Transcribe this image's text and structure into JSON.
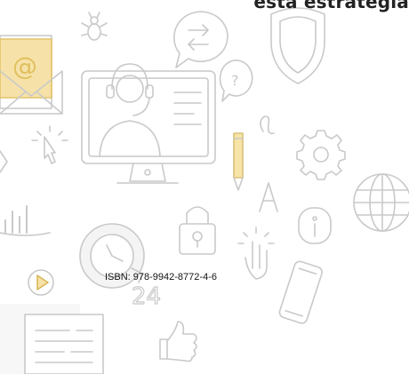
{
  "header": {
    "title": "esta estrategia"
  },
  "footer": {
    "isbn": "ISBN: 978-9942-8772-4-6"
  },
  "colors": {
    "stroke": "#c9c9c9",
    "envelope_accent": "#f6e2a8",
    "pencil_accent": "#f7e4a6",
    "chart_accent": "#f2ecd8",
    "text": "#111111"
  },
  "icons": [
    "envelope-icon",
    "bug-icon",
    "chat-bubble-icon",
    "shield-icon",
    "support-agent-monitor-icon",
    "question-bubble-icon",
    "pencil-icon",
    "gear-icon",
    "globe-icon",
    "cursor-click-icon",
    "padlock-icon",
    "clock-24h-icon",
    "info-icon",
    "hand-tap-icon",
    "play-button-icon",
    "smartphone-icon",
    "bar-chart-icon",
    "document-icon",
    "thumbs-up-icon",
    "letter-a-icon"
  ]
}
